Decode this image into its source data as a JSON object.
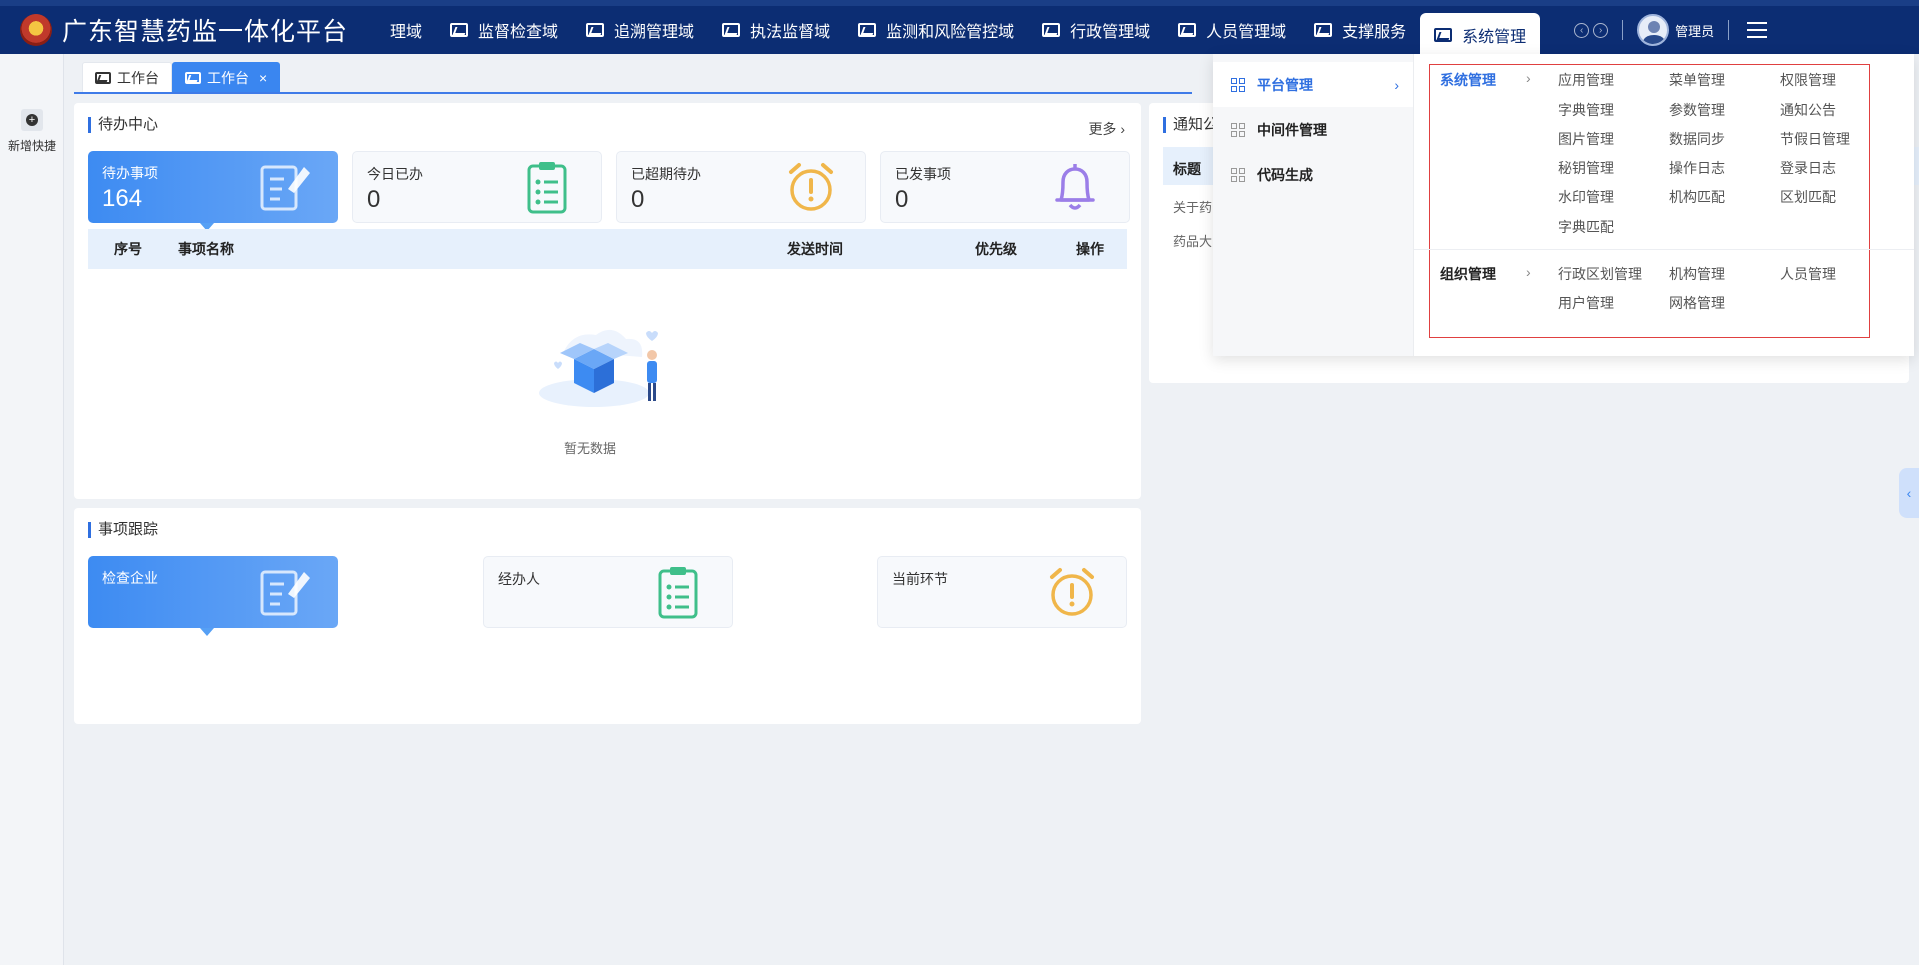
{
  "header": {
    "app_title": "广东智慧药监一体化平台",
    "nav": [
      {
        "label": "理域",
        "has_icon": false
      },
      {
        "label": "监督检查域",
        "has_icon": true
      },
      {
        "label": "追溯管理域",
        "has_icon": true
      },
      {
        "label": "执法监督域",
        "has_icon": true
      },
      {
        "label": "监测和风险管控域",
        "has_icon": true
      },
      {
        "label": "行政管理域",
        "has_icon": true
      },
      {
        "label": "人员管理域",
        "has_icon": true
      },
      {
        "label": "支撑服务",
        "has_icon": true
      },
      {
        "label": "系统管理",
        "has_icon": true,
        "active": true
      }
    ],
    "user_name": "管理员"
  },
  "leftrail": {
    "quick_add_label": "新增快捷"
  },
  "tabs": [
    {
      "label": "工作台",
      "active": false
    },
    {
      "label": "工作台",
      "active": true,
      "close": "×"
    }
  ],
  "todo_center": {
    "title": "待办中心",
    "more": "更多",
    "stats": [
      {
        "label": "待办事项",
        "value": "164",
        "icon": "edit-document-icon"
      },
      {
        "label": "今日已办",
        "value": "0",
        "icon": "clipboard-list-icon"
      },
      {
        "label": "已超期待办",
        "value": "0",
        "icon": "alarm-clock-icon"
      },
      {
        "label": "已发事项",
        "value": "0",
        "icon": "bell-icon"
      }
    ],
    "columns": [
      "序号",
      "事项名称",
      "发送时间",
      "优先级",
      "操作"
    ],
    "empty_text": "暂无数据"
  },
  "tracking": {
    "title": "事项跟踪",
    "stats": [
      {
        "label": "检查企业",
        "icon": "edit-document-icon"
      },
      {
        "label": "经办人",
        "icon": "clipboard-list-icon"
      },
      {
        "label": "当前环节",
        "icon": "alarm-clock-icon"
      }
    ]
  },
  "notice": {
    "title": "通知公",
    "column": "标题",
    "rows": [
      "关于药",
      "药品大"
    ]
  },
  "mega_menu": {
    "left": [
      {
        "label": "平台管理",
        "active": true
      },
      {
        "label": "中间件管理",
        "active": false
      },
      {
        "label": "代码生成",
        "active": false
      }
    ],
    "groups": [
      {
        "label": "系统管理",
        "items": [
          "应用管理",
          "菜单管理",
          "权限管理",
          "字典管理",
          "参数管理",
          "通知公告",
          "图片管理",
          "数据同步",
          "节假日管理",
          "秘钥管理",
          "操作日志",
          "登录日志",
          "水印管理",
          "机构匹配",
          "区划匹配",
          "字典匹配"
        ]
      },
      {
        "label": "组织管理",
        "items": [
          "行政区划管理",
          "机构管理",
          "人员管理",
          "用户管理",
          "网格管理"
        ]
      }
    ]
  },
  "colors": {
    "header_bg": "#0c2d73",
    "accent": "#2f6fe0",
    "highlight_border": "#e04040"
  }
}
